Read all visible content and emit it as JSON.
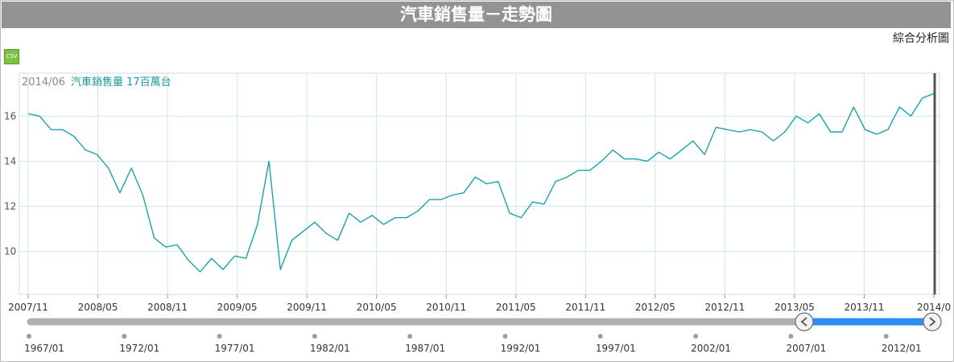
{
  "title": "汽車銷售量－走勢圖",
  "analysis_link": "綜合分析圖",
  "csv_label": "CSV",
  "colors": {
    "title_bg": "#939393",
    "line": "#1aa3a6",
    "grid": "#cfe6ee",
    "scroll_track": "#b0b0b0",
    "scroll_selected": "#2f8cf0"
  },
  "legend": {
    "date": "2014/06",
    "series_text": "汽車銷售量 17百萬台"
  },
  "chart_data": {
    "type": "line",
    "y_ticks": [
      10,
      12,
      14,
      16
    ],
    "ylim": [
      8.1,
      17.9
    ],
    "x_tick_labels": [
      "2007/11",
      "2008/05",
      "2008/11",
      "2009/05",
      "2009/11",
      "2010/05",
      "2010/11",
      "2011/05",
      "2011/11",
      "2012/05",
      "2012/11",
      "2013/05",
      "2013/11",
      "2014/0"
    ],
    "series": [
      {
        "values": [
          16.1,
          16.0,
          15.4,
          15.4,
          15.1,
          14.5,
          14.3,
          13.7,
          12.6,
          13.7,
          12.5,
          10.6,
          10.2,
          10.3,
          9.6,
          9.1,
          9.7,
          9.2,
          9.8,
          9.7,
          11.2,
          14.0,
          9.2,
          10.5,
          10.9,
          11.3,
          10.8,
          10.5,
          11.7,
          11.3,
          11.6,
          11.2,
          11.5,
          11.5,
          11.8,
          12.3,
          12.3,
          12.5,
          12.6,
          13.3,
          13.0,
          13.1,
          11.7,
          11.5,
          12.2,
          12.1,
          13.1,
          13.3,
          13.6,
          13.6,
          14.0,
          14.5,
          14.1,
          14.1,
          14.0,
          14.4,
          14.1,
          14.5,
          14.9,
          14.3,
          15.5,
          15.4,
          15.3,
          15.4,
          15.3,
          14.9,
          15.3,
          16.0,
          15.7,
          16.1,
          15.3,
          15.3,
          16.4,
          15.4,
          15.2,
          15.4,
          16.4,
          16.0,
          16.8,
          17.0
        ]
      }
    ],
    "range_selector": {
      "labels": [
        "1967/01",
        "1972/01",
        "1977/01",
        "1982/01",
        "1987/01",
        "1992/01",
        "1997/01",
        "2002/01",
        "2007/01",
        "2012/01"
      ],
      "selected_fraction": [
        0.858,
        1.0
      ]
    }
  }
}
